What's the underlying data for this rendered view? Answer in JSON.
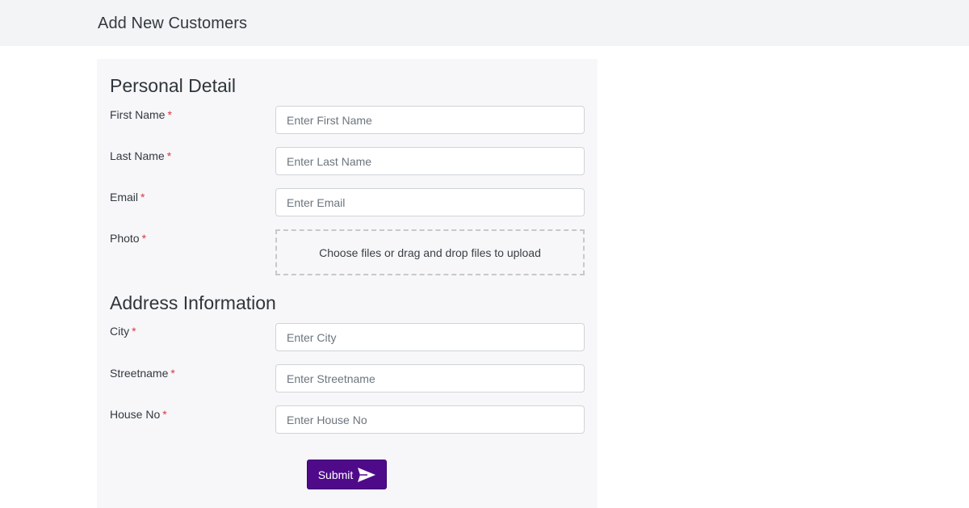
{
  "header": {
    "title": "Add New Customers"
  },
  "personal": {
    "heading": "Personal Detail",
    "required_mark": "*",
    "first_name": {
      "label": "First Name",
      "placeholder": "Enter First Name",
      "value": ""
    },
    "last_name": {
      "label": "Last Name",
      "placeholder": "Enter Last Name",
      "value": ""
    },
    "email": {
      "label": "Email",
      "placeholder": "Enter Email",
      "value": ""
    },
    "photo": {
      "label": "Photo",
      "dropzone_text": "Choose files or drag and drop files to upload"
    }
  },
  "address": {
    "heading": "Address Information",
    "required_mark": "*",
    "city": {
      "label": "City",
      "placeholder": "Enter City",
      "value": ""
    },
    "streetname": {
      "label": "Streetname",
      "placeholder": "Enter Streetname",
      "value": ""
    },
    "house_no": {
      "label": "House No",
      "placeholder": "Enter House No",
      "value": ""
    }
  },
  "form": {
    "submit_label": "Submit",
    "submit_icon": "send-icon"
  },
  "colors": {
    "accent": "#4f0a8a",
    "required": "#dc3545",
    "topbar": "#f3f4f6",
    "panel": "#f7f7f9"
  }
}
